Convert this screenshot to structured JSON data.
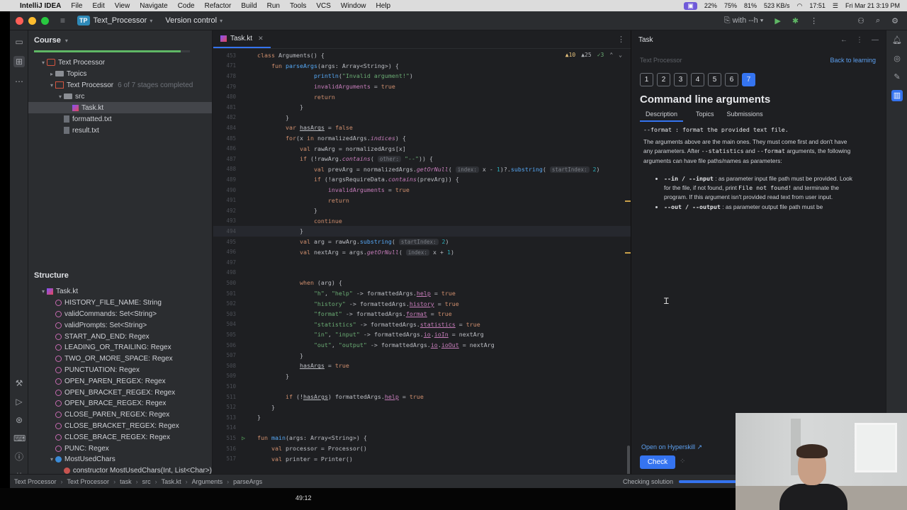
{
  "menubar": {
    "app": "IntelliJ IDEA",
    "items": [
      "File",
      "Edit",
      "View",
      "Navigate",
      "Code",
      "Refactor",
      "Build",
      "Run",
      "Tools",
      "VCS",
      "Window",
      "Help"
    ],
    "battery": "22%",
    "cpu": "75%",
    "mem": "81%",
    "net": "523 KB/s",
    "clock": "17:51",
    "date": "Fri Mar 21  3:19 PM"
  },
  "titlebar": {
    "badge": "TP",
    "project": "Text_Processor",
    "vcs": "Version control",
    "run_config": "with --h"
  },
  "course": {
    "header": "Course",
    "progress_pct": 94,
    "tree": [
      {
        "label": "Text Processor",
        "icon": "course",
        "level": 1,
        "arrow": "▾"
      },
      {
        "label": "Topics",
        "icon": "folder",
        "level": 2,
        "arrow": "▸"
      },
      {
        "label": "Text Processor",
        "icon": "task",
        "level": 2,
        "arrow": "▾",
        "note": "6 of 7 stages completed"
      },
      {
        "label": "src",
        "icon": "folder",
        "level": 3,
        "arrow": "▾"
      },
      {
        "label": "Task.kt",
        "icon": "kt",
        "level": 4,
        "arrow": "",
        "selected": true
      },
      {
        "label": "formatted.txt",
        "icon": "file",
        "level": 3,
        "arrow": ""
      },
      {
        "label": "result.txt",
        "icon": "file",
        "level": 3,
        "arrow": ""
      }
    ]
  },
  "structure": {
    "header": "Structure",
    "items": [
      {
        "label": "Task.kt",
        "icon": "kt",
        "level": 1,
        "arrow": "▾"
      },
      {
        "label": "HISTORY_FILE_NAME: String",
        "icon": "prop",
        "level": 2
      },
      {
        "label": "validCommands: Set<String>",
        "icon": "prop",
        "level": 2
      },
      {
        "label": "validPrompts: Set<String>",
        "icon": "prop",
        "level": 2
      },
      {
        "label": "START_AND_END: Regex",
        "icon": "prop",
        "level": 2
      },
      {
        "label": "LEADING_OR_TRAILING: Regex",
        "icon": "prop",
        "level": 2
      },
      {
        "label": "TWO_OR_MORE_SPACE: Regex",
        "icon": "prop",
        "level": 2
      },
      {
        "label": "PUNCTUATION: Regex",
        "icon": "prop",
        "level": 2
      },
      {
        "label": "OPEN_PAREN_REGEX: Regex",
        "icon": "prop",
        "level": 2
      },
      {
        "label": "OPEN_BRACKET_REGEX: Regex",
        "icon": "prop",
        "level": 2
      },
      {
        "label": "OPEN_BRACE_REGEX: Regex",
        "icon": "prop",
        "level": 2
      },
      {
        "label": "CLOSE_PAREN_REGEX: Regex",
        "icon": "prop",
        "level": 2
      },
      {
        "label": "CLOSE_BRACKET_REGEX: Regex",
        "icon": "prop",
        "level": 2
      },
      {
        "label": "CLOSE_BRACE_REGEX: Regex",
        "icon": "prop",
        "level": 2
      },
      {
        "label": "PUNC: Regex",
        "icon": "prop",
        "level": 2
      },
      {
        "label": "MostUsedChars",
        "icon": "cls",
        "level": 2,
        "arrow": "▾"
      },
      {
        "label": "constructor MostUsedChars(Int, List<Char>)",
        "icon": "ctor",
        "level": 3
      }
    ]
  },
  "editor": {
    "tab": "Task.kt",
    "inspections": {
      "warnings": "10",
      "weak": "25",
      "typos": "3"
    },
    "lines": [
      {
        "n": "453",
        "html": "<span class='kw'>class</span> Arguments() {"
      },
      {
        "n": "471",
        "html": "    <span class='kw'>fun</span> <span class='fn'>parseArgs</span>(args: Array&lt;String&gt;) {"
      },
      {
        "n": "478",
        "html": "                <span class='fn'>println</span>(<span class='str'>\"Invalid argument!\"</span>)"
      },
      {
        "n": "479",
        "html": "                <span class='prp'>invalidArguments</span> = <span class='kw'>true</span>"
      },
      {
        "n": "480",
        "html": "                <span class='kw'>return</span>"
      },
      {
        "n": "481",
        "html": "            }"
      },
      {
        "n": "482",
        "html": "        }"
      },
      {
        "n": "484",
        "html": "        <span class='kw'>var</span> <span class='under'>hasArgs</span> = <span class='kw'>false</span>"
      },
      {
        "n": "485",
        "html": "        <span class='kw'>for</span>(x <span class='kw'>in</span> normalizedArgs.<span class='ital'>indices</span>) {"
      },
      {
        "n": "486",
        "html": "            <span class='kw'>val</span> rawArg = normalizedArgs[x]"
      },
      {
        "n": "487",
        "html": "            <span class='kw'>if</span> (!rawArg.<span class='ital'>contains</span>( <span class='hint'>other:</span> <span class='str'>\"--\"</span>)) {"
      },
      {
        "n": "488",
        "html": "                <span class='kw'>val</span> prevArg = normalizedArgs.<span class='ital'>getOrNull</span>( <span class='hint'>index:</span> x - <span class='num'>1</span>)?.<span class='fn'>substring</span>( <span class='hint'>startIndex:</span> <span class='num'>2</span>)"
      },
      {
        "n": "489",
        "html": "                <span class='kw'>if</span> (!argsRequireData.<span class='ital'>contains</span>(prevArg)) {"
      },
      {
        "n": "490",
        "html": "                    <span class='prp'>invalidArguments</span> = <span class='kw'>true</span>"
      },
      {
        "n": "491",
        "html": "                    <span class='kw'>return</span>"
      },
      {
        "n": "492",
        "html": "                }"
      },
      {
        "n": "493",
        "html": "                <span class='kw'>continue</span>"
      },
      {
        "n": "494",
        "html": "            }",
        "current": true
      },
      {
        "n": "495",
        "html": "            <span class='kw'>val</span> arg = rawArg.<span class='fn'>substring</span>( <span class='hint'>startIndex:</span> <span class='num'>2</span>)"
      },
      {
        "n": "496",
        "html": "            <span class='kw'>val</span> nextArg = args.<span class='ital'>getOrNull</span>( <span class='hint'>index:</span> x + <span class='num'>1</span>)"
      },
      {
        "n": "497",
        "html": ""
      },
      {
        "n": "498",
        "html": ""
      },
      {
        "n": "500",
        "html": "            <span class='kw'>when</span> (arg) {"
      },
      {
        "n": "501",
        "html": "                <span class='str'>\"h\"</span>, <span class='str'>\"help\"</span> -&gt; formattedArgs.<span class='prp under'>help</span> = <span class='kw'>true</span>"
      },
      {
        "n": "502",
        "html": "                <span class='str'>\"history\"</span> -&gt; formattedArgs.<span class='prp under'>history</span> = <span class='kw'>true</span>"
      },
      {
        "n": "503",
        "html": "                <span class='str'>\"format\"</span> -&gt; formattedArgs.<span class='prp under'>format</span> = <span class='kw'>true</span>"
      },
      {
        "n": "504",
        "html": "                <span class='str'>\"statistics\"</span> -&gt; formattedArgs.<span class='prp under'>statistics</span> = <span class='kw'>true</span>"
      },
      {
        "n": "505",
        "html": "                <span class='str'>\"in\"</span>, <span class='str'>\"input\"</span> -&gt; formattedArgs.<span class='prp under'>io</span>.<span class='prp under'>ioIn</span> = nextArg"
      },
      {
        "n": "506",
        "html": "                <span class='str'>\"out\"</span>, <span class='str'>\"output\"</span> -&gt; formattedArgs.<span class='prp under'>io</span>.<span class='prp under'>ioOut</span> = nextArg"
      },
      {
        "n": "507",
        "html": "            }"
      },
      {
        "n": "508",
        "html": "            <span class='under'>hasArgs</span> = <span class='kw'>true</span>"
      },
      {
        "n": "509",
        "html": "        }"
      },
      {
        "n": "510",
        "html": ""
      },
      {
        "n": "511",
        "html": "        <span class='kw'>if</span> (!<span class='under'>hasArgs</span>) formattedArgs.<span class='prp under'>help</span> = <span class='kw'>true</span>"
      },
      {
        "n": "512",
        "html": "    }"
      },
      {
        "n": "513",
        "html": "}"
      },
      {
        "n": "514",
        "html": ""
      },
      {
        "n": "515",
        "html": "<span class='kw'>fun</span> <span class='fn'>main</span>(args: Array&lt;String&gt;) {",
        "run": true
      },
      {
        "n": "516",
        "html": "    <span class='kw'>val</span> processor = Processor()"
      },
      {
        "n": "517",
        "html": "    <span class='kw'>val</span> printer = Printer()"
      }
    ]
  },
  "task": {
    "header": "Task",
    "crumb": "Text Processor",
    "back": "Back to learning",
    "stages": [
      "1",
      "2",
      "3",
      "4",
      "5",
      "6",
      "7"
    ],
    "current_stage": "7",
    "title": "Command line arguments",
    "tabs": [
      "Description",
      "Topics",
      "Submissions"
    ],
    "cut_line": "--format : format the provided text file.",
    "para_a": "The arguments above are the main ones. They must come first and don't have any parameters. After ",
    "para_b": " and ",
    "para_c": " arguments, the following arguments can have file paths/names as parameters:",
    "code_stats": "--statistics",
    "code_format": "--format",
    "bullet1_code": "--in / --input",
    "bullet1_a": " : as parameter input file path must be provided. Look for the file, if not found, print ",
    "bullet1_code2": "File not found!",
    "bullet1_b": " and terminate the program. If this argument isn't provided read text from user input.",
    "bullet2_code": "--out / --output",
    "bullet2_a": " : as parameter output file path must be",
    "hyperskill": "Open on Hyperskill ↗",
    "check": "Check"
  },
  "statusbar": {
    "crumbs": [
      "Text Processor",
      "Text Processor",
      "task",
      "src",
      "Task.kt",
      "Arguments",
      "parseArgs"
    ],
    "checking": "Checking solution",
    "progress_pct": 60
  },
  "overlay": {
    "time": "49:12"
  }
}
